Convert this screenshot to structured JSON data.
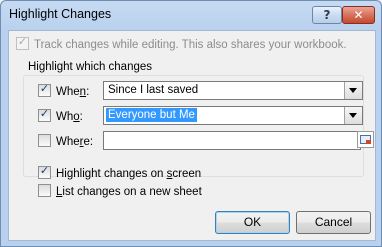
{
  "window": {
    "title": "Highlight Changes",
    "help_glyph": "?",
    "close_glyph": "✕"
  },
  "track_changes": {
    "label": "Track changes while editing. This also shares your workbook.",
    "checked": true,
    "enabled": false
  },
  "highlight_group": {
    "label": "Highlight which changes",
    "when": {
      "label_pre": "Whe",
      "label_ul": "n",
      "label_post": ":",
      "checked": true,
      "value": "Since I last saved"
    },
    "who": {
      "label_pre": "Wh",
      "label_ul": "o",
      "label_post": ":",
      "checked": true,
      "value": "Everyone but Me"
    },
    "where": {
      "label_pre": "Whe",
      "label_ul": "r",
      "label_post": "e:",
      "checked": false,
      "value": ""
    }
  },
  "options": {
    "highlight_on_screen": {
      "pre": "Highlight changes on ",
      "ul": "s",
      "post": "creen",
      "checked": true
    },
    "list_new_sheet": {
      "pre": "",
      "ul": "L",
      "post": "ist changes on a new sheet",
      "checked": false
    }
  },
  "buttons": {
    "ok": "OK",
    "cancel": "Cancel"
  },
  "check_glyph": "✓",
  "icons": {
    "dropdown": "chevron-down-icon",
    "ref": "range-select-icon"
  }
}
